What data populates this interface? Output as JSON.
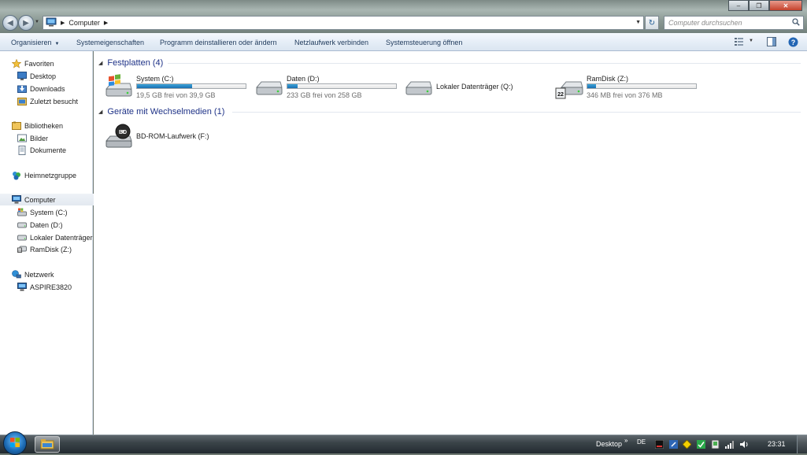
{
  "window": {
    "address_path": "Computer",
    "search_placeholder": "Computer durchsuchen",
    "min_label": "–",
    "max_label": "❐",
    "close_label": "✕"
  },
  "toolbar": {
    "organize": "Organisieren",
    "system_properties": "Systemeigenschaften",
    "uninstall": "Programm deinstallieren oder ändern",
    "map_network_drive": "Netzlaufwerk verbinden",
    "control_panel": "Systemsteuerung öffnen"
  },
  "sidebar": {
    "favorites": {
      "label": "Favoriten",
      "items": [
        "Desktop",
        "Downloads",
        "Zuletzt besucht"
      ]
    },
    "libraries": {
      "label": "Bibliotheken",
      "items": [
        "Bilder",
        "Dokumente"
      ]
    },
    "homegroup": "Heimnetzgruppe",
    "computer": {
      "label": "Computer",
      "items": [
        "System (C:)",
        "Daten (D:)",
        "Lokaler Datenträger",
        "RamDisk (Z:)"
      ]
    },
    "network": {
      "label": "Netzwerk",
      "items": [
        "ASPIRE3820"
      ]
    }
  },
  "groups": {
    "hard_disks": {
      "title": "Festplatten (4)",
      "drives": [
        {
          "name": "System (C:)",
          "info": "19,5 GB frei von 39,9 GB",
          "used_fraction": 0.51
        },
        {
          "name": "Daten (D:)",
          "info": "233 GB frei von 258 GB",
          "used_fraction": 0.097
        },
        {
          "name": "Lokaler Datenträger (Q:)",
          "info": ""
        },
        {
          "name": "RamDisk (Z:)",
          "info": "346 MB frei von 376 MB",
          "used_fraction": 0.08
        }
      ]
    },
    "removable": {
      "title": "Geräte mit Wechselmedien (1)",
      "drives": [
        {
          "name": "BD-ROM-Laufwerk (F:)"
        }
      ]
    }
  },
  "taskbar": {
    "desktop_label": "Desktop",
    "language": "DE",
    "clock": "23:31"
  }
}
